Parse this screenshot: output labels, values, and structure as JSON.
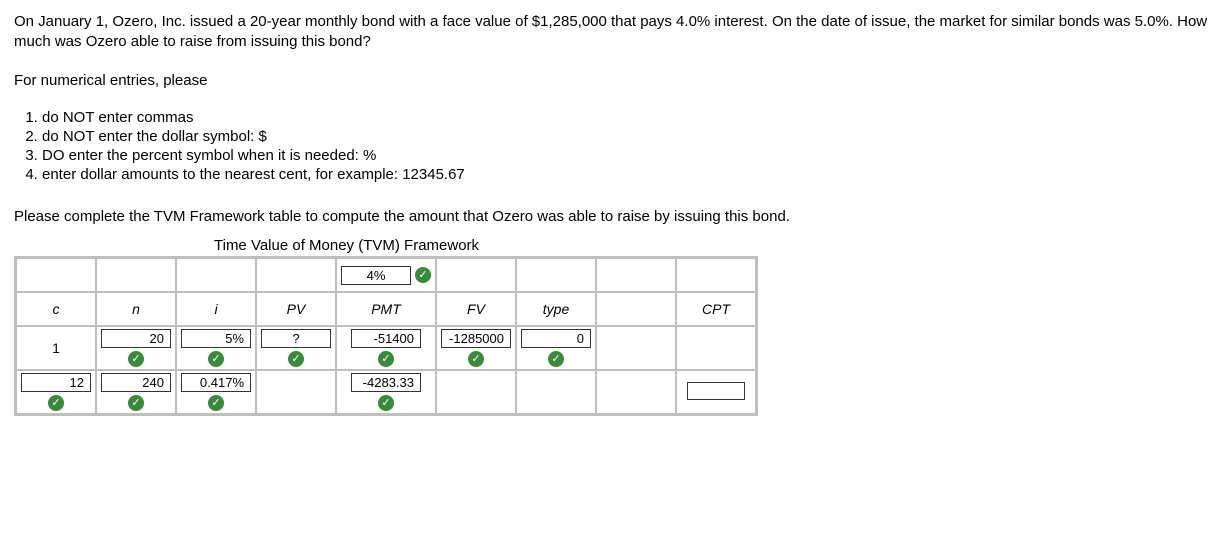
{
  "intro": {
    "p1": "On January 1, Ozero, Inc. issued a 20-year monthly bond with a face value of $1,285,000 that pays 4.0% interest.  On the date of issue, the market for similar bonds was 5.0%.  How much was Ozero able to raise from issuing this bond?",
    "p2": "For numerical entries, please",
    "rules": [
      "do NOT enter commas",
      "do NOT enter the dollar symbol: $",
      "DO enter the percent symbol when it is needed: %",
      "enter dollar amounts to the nearest cent, for example:  12345.67"
    ],
    "p3": "Please complete the TVM Framework table to compute the amount that Ozero was able to raise by issuing this bond."
  },
  "table": {
    "title": "Time Value of Money (TVM) Framework",
    "headers": {
      "c": "c",
      "n": "n",
      "i": "i",
      "pv": "PV",
      "pmt": "PMT",
      "fv": "FV",
      "type": "type",
      "cpt": "CPT"
    },
    "top_pmt": "4%",
    "row1": {
      "c": "1",
      "n": "20",
      "i": "5%",
      "pv": "?",
      "pmt": "-51400",
      "fv": "-1285000",
      "type": "0"
    },
    "row2": {
      "c": "12",
      "n": "240",
      "i": "0.417%",
      "pmt": "-4283.33"
    }
  },
  "chart_data": {
    "type": "table",
    "title": "Time Value of Money (TVM) Framework",
    "columns": [
      "c",
      "n",
      "i",
      "PV",
      "PMT",
      "FV",
      "type",
      "CPT"
    ],
    "annual_coupon_rate": "4%",
    "rows": [
      {
        "c": 1,
        "n": 20,
        "i": "5%",
        "PV": "?",
        "PMT": -51400,
        "FV": -1285000,
        "type": 0,
        "CPT": null
      },
      {
        "c": 12,
        "n": 240,
        "i": "0.417%",
        "PV": null,
        "PMT": -4283.33,
        "FV": null,
        "type": null,
        "CPT": ""
      }
    ]
  }
}
